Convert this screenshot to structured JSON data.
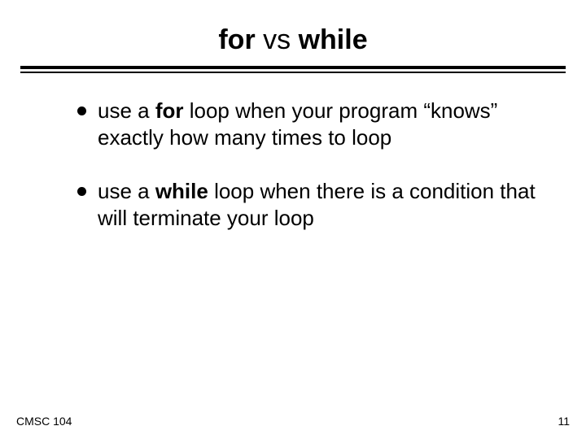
{
  "title": {
    "part1": "for",
    "part2": " vs ",
    "part3": "while"
  },
  "bullets": [
    {
      "pre": "use a ",
      "bold": "for",
      "post": " loop when your program “knows” exactly how many times to loop"
    },
    {
      "pre": "use a ",
      "bold": "while",
      "post": " loop when there is a condition that will terminate your loop"
    }
  ],
  "footer": {
    "left": "CMSC 104",
    "right": "11"
  }
}
